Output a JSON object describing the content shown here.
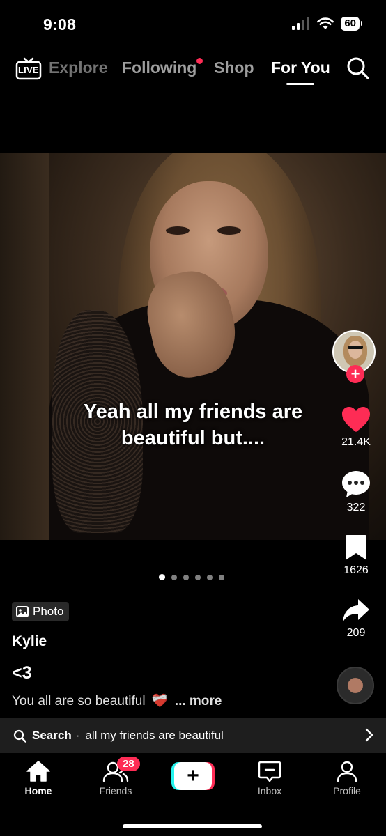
{
  "status_bar": {
    "time": "9:08",
    "battery": "60"
  },
  "top_nav": {
    "live_label": "LIVE",
    "tabs": [
      {
        "label": "Explore"
      },
      {
        "label": "Following"
      },
      {
        "label": "Shop"
      },
      {
        "label": "For You"
      }
    ],
    "active_tab": "For You"
  },
  "post": {
    "caption_lines": [
      "Yeah all my friends are",
      "beautiful but...."
    ],
    "photo_count": 6,
    "active_photo_index": 0,
    "type_badge": "Photo",
    "username": "Kylie",
    "title": "<3",
    "description": "You all are so beautiful",
    "description_emoji": "❤️‍🩹",
    "more_label": "... more"
  },
  "actions": {
    "likes": "21.4K",
    "comments": "322",
    "saves": "1626",
    "shares": "209"
  },
  "search_suggestion": {
    "label": "Search",
    "separator": "·",
    "query": "all my friends are beautiful"
  },
  "bottom_nav": {
    "items": [
      {
        "label": "Home"
      },
      {
        "label": "Friends"
      },
      {
        "label": "Inbox"
      },
      {
        "label": "Profile"
      }
    ],
    "friends_badge": "28",
    "active": "Home"
  },
  "colors": {
    "accent": "#fe2c55",
    "cyan": "#25f4ee",
    "background": "#000000"
  }
}
